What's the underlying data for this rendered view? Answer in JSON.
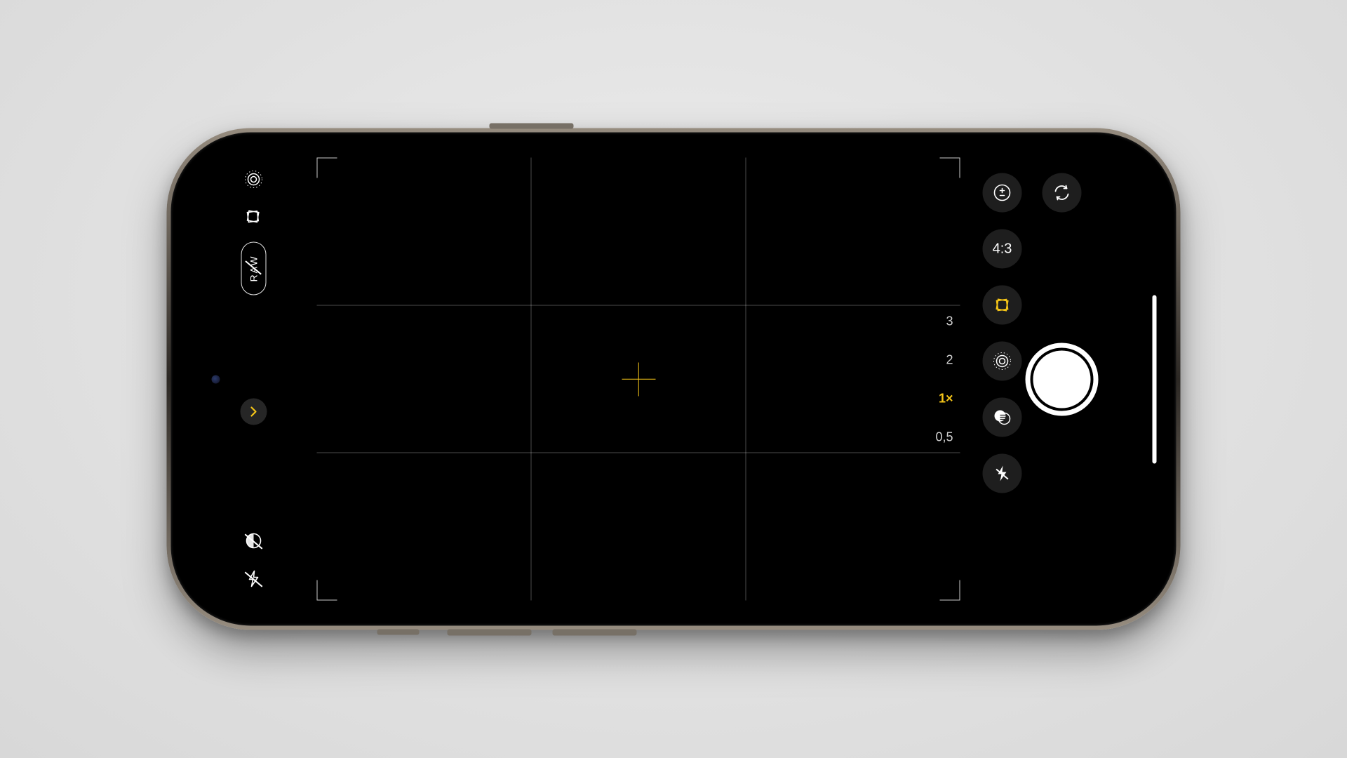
{
  "accent": "#f5c518",
  "left_controls": {
    "live_photo": {
      "name": "live-photo"
    },
    "photographic_style": {
      "name": "photographic-style"
    },
    "raw_toggle": {
      "label": "RAW",
      "enabled": false
    },
    "drawer": {
      "name": "tools-drawer"
    },
    "night_mode": {
      "name": "night-mode",
      "enabled": false
    },
    "flash_toggle": {
      "name": "flash",
      "enabled": false
    }
  },
  "zoom": {
    "options": [
      "3",
      "2",
      "1×",
      "0,5"
    ],
    "selected_index": 2
  },
  "right_rail": {
    "exposure": {
      "name": "exposure-compensation"
    },
    "aspect_ratio": {
      "label": "4:3"
    },
    "photographic_style_active": {
      "name": "photographic-style"
    },
    "live_photo_tool": {
      "name": "live-photo"
    },
    "filters": {
      "name": "filters"
    },
    "flash": {
      "name": "flash",
      "enabled": false
    }
  },
  "top_right": {
    "camera_switch": {
      "name": "switch-camera"
    }
  },
  "shutter": {
    "name": "shutter"
  }
}
